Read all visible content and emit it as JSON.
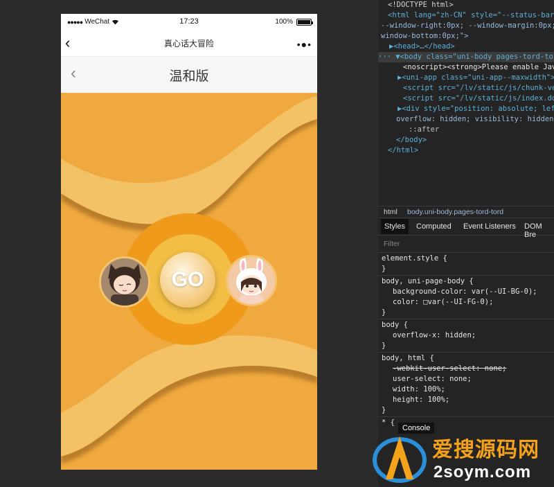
{
  "phone": {
    "status": {
      "signal": "●●●●●",
      "carrier": "WeChat",
      "time": "17:23",
      "battery_text": "100%"
    },
    "nav": {
      "back": "‹",
      "title": "真心话大冒险",
      "more": "•●•"
    },
    "header": {
      "back": "‹",
      "title": "温和版"
    },
    "go_label": "GO",
    "colors": {
      "bg": "#f0a93e",
      "ring_outer": "#ef9a1a",
      "ring_mid": "#f2be45",
      "wave_light": "#f4c266",
      "wave_shadow": "#8e5a1a"
    }
  },
  "devtools": {
    "dom": [
      "<!DOCTYPE html>",
      "<html lang=\"zh-CN\" style=\"--status-bar-he",
      "--window-right:0px; --window-margin:0px; -",
      "window-bottom:0px;\">",
      "▶<head>…</head>",
      "··· ▼<body class=\"uni-body pages-tord-tord\"",
      "<noscript><strong>Please enable JavaS",
      "▶<uni-app class=\"uni-app--maxwidth\">…<",
      "<script src=\"/lv/static/js/chunk-vend",
      "<script src=\"/lv/static/js/index.dd97",
      "▶<div style=\"position: absolute; left:",
      "overflow: hidden; visibility: hidden;\">",
      "::after",
      "</body>",
      "</html>"
    ],
    "crumbs": [
      "html",
      "body.uni-body.pages-tord-tord"
    ],
    "tabs": [
      "Styles",
      "Computed",
      "Event Listeners",
      "DOM Bre"
    ],
    "filter": "Filter",
    "rules": [
      "element.style {",
      "}",
      "body, uni-page-body {",
      "background-color: var(--UI-BG-0);",
      "color: □var(--UI-FG-0);",
      "}",
      "body {",
      "overflow-x: hidden;",
      "}",
      "body, html {",
      "-webkit-user-select: none;",
      "user-select: none;",
      "width: 100%;",
      "height: 100%;",
      "}",
      "* {"
    ],
    "console_tip": "Console"
  },
  "watermark": {
    "line1": "爱搜源码网",
    "line2": "2soym.com"
  }
}
